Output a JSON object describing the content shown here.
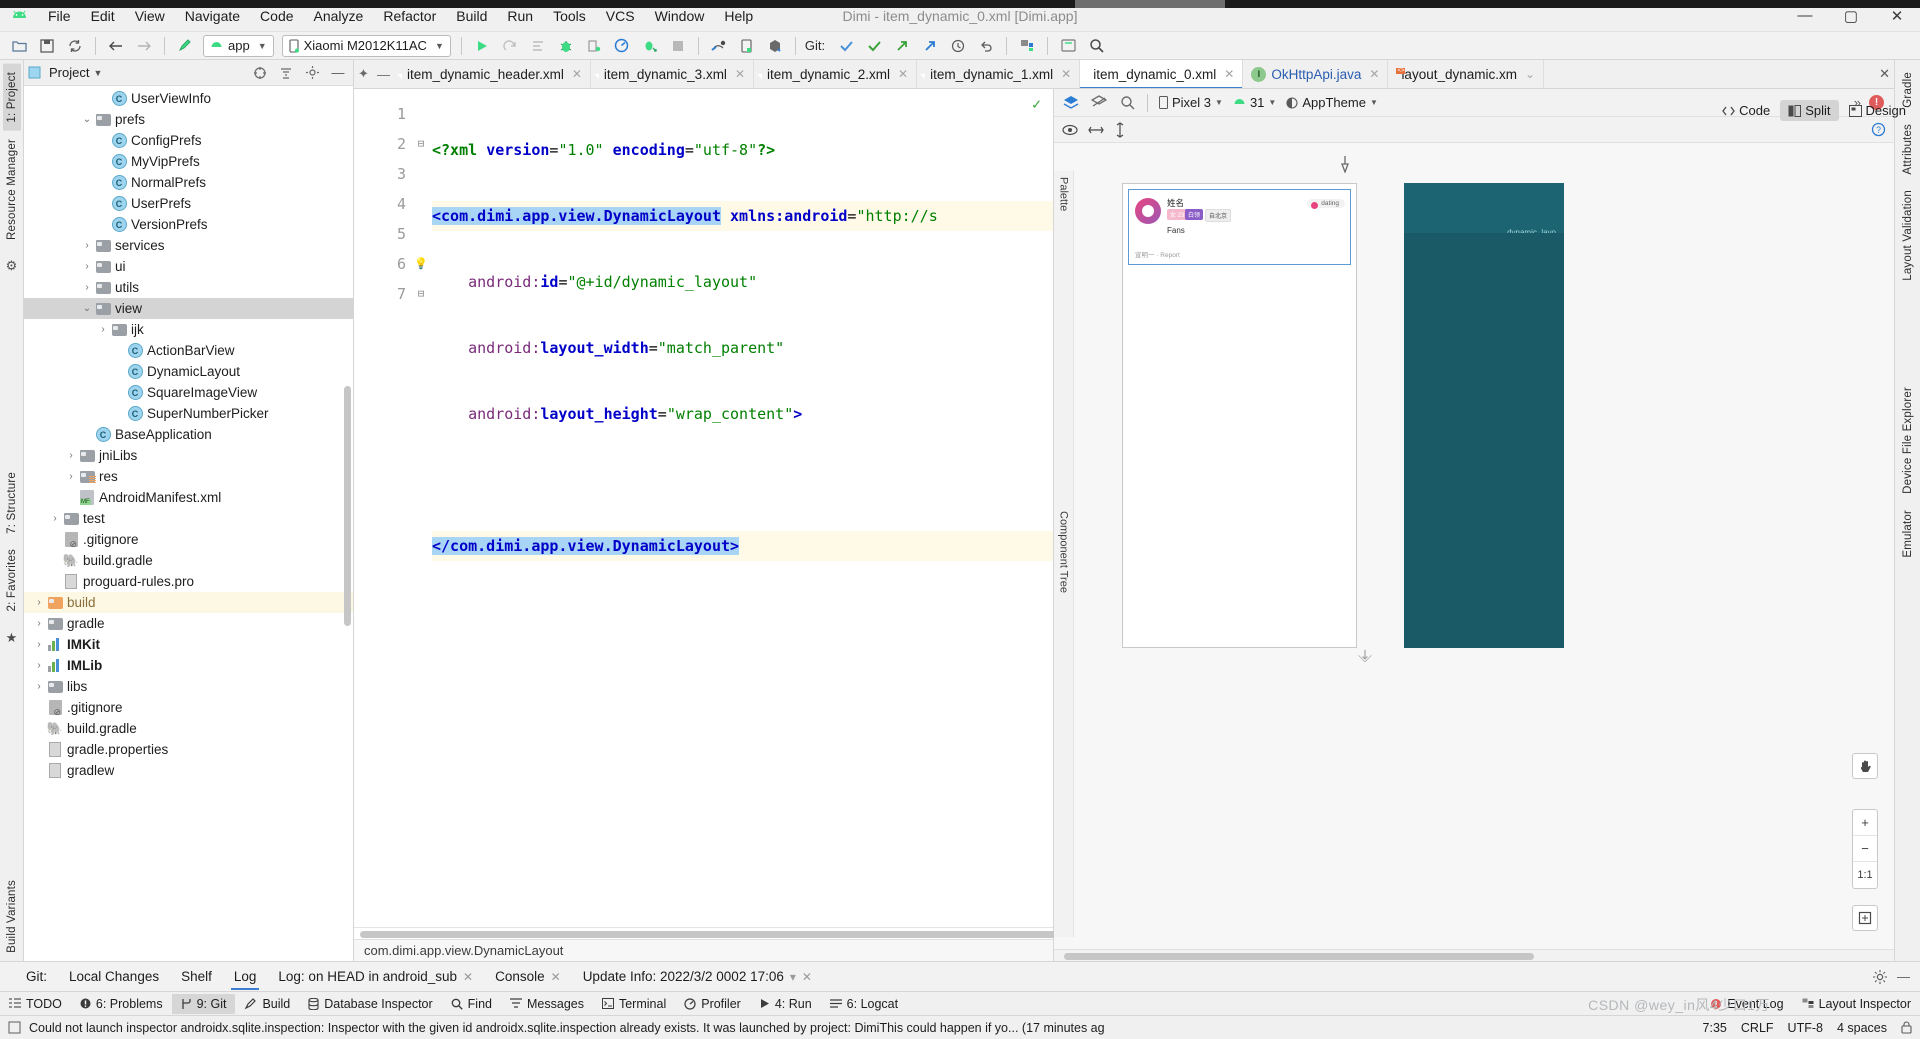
{
  "window": {
    "title": "Dimi - item_dynamic_0.xml [Dimi.app]",
    "minimize": "—",
    "maximize": "▢",
    "close": "✕"
  },
  "menu": [
    "File",
    "Edit",
    "View",
    "Navigate",
    "Code",
    "Analyze",
    "Refactor",
    "Build",
    "Run",
    "Tools",
    "VCS",
    "Window",
    "Help"
  ],
  "toolbar": {
    "module_selector": "app",
    "device_selector": "Xiaomi M2012K11AC",
    "git_label": "Git:",
    "icons": [
      "open-folder-icon",
      "save-all-icon",
      "sync-icon",
      "back-icon",
      "forward-icon",
      "build-hammer-icon",
      "run-icon",
      "rerun-icon",
      "run-config-icon",
      "debug-icon",
      "attach-debugger-icon",
      "profiler-icon",
      "apply-changes-icon",
      "stop-icon",
      "sdk-manager-icon",
      "avd-manager-icon",
      "device-explorer-icon",
      "git-update-icon",
      "git-commit-icon",
      "git-push-icon",
      "git-history-icon",
      "git-revert-icon",
      "layout-inspector-icon",
      "search-everywhere-icon"
    ]
  },
  "project_panel": {
    "title": "Project",
    "header_icons": [
      "locate-icon",
      "collapse-all-icon",
      "settings-gear-icon",
      "hide-icon"
    ],
    "tree": [
      {
        "label": "UserViewInfo",
        "indent": 7,
        "icon": "class-icon",
        "arrow": ""
      },
      {
        "label": "prefs",
        "indent": 6,
        "icon": "folder-icon",
        "arrow": "v"
      },
      {
        "label": "ConfigPrefs",
        "indent": 7,
        "icon": "class-icon",
        "arrow": ""
      },
      {
        "label": "MyVipPrefs",
        "indent": 7,
        "icon": "class-icon",
        "arrow": ""
      },
      {
        "label": "NormalPrefs",
        "indent": 7,
        "icon": "class-icon",
        "arrow": ""
      },
      {
        "label": "UserPrefs",
        "indent": 7,
        "icon": "class-icon",
        "arrow": ""
      },
      {
        "label": "VersionPrefs",
        "indent": 7,
        "icon": "class-icon",
        "arrow": ""
      },
      {
        "label": "services",
        "indent": 6,
        "icon": "folder-icon",
        "arrow": ">"
      },
      {
        "label": "ui",
        "indent": 6,
        "icon": "folder-icon",
        "arrow": ">"
      },
      {
        "label": "utils",
        "indent": 6,
        "icon": "folder-icon",
        "arrow": ">"
      },
      {
        "label": "view",
        "indent": 6,
        "icon": "folder-icon",
        "arrow": "v",
        "selected": true
      },
      {
        "label": "ijk",
        "indent": 7,
        "icon": "folder-icon",
        "arrow": ">"
      },
      {
        "label": "ActionBarView",
        "indent": 8,
        "icon": "class-icon",
        "arrow": ""
      },
      {
        "label": "DynamicLayout",
        "indent": 8,
        "icon": "class-icon",
        "arrow": ""
      },
      {
        "label": "SquareImageView",
        "indent": 8,
        "icon": "class-icon",
        "arrow": ""
      },
      {
        "label": "SuperNumberPicker",
        "indent": 8,
        "icon": "class-icon",
        "arrow": ""
      },
      {
        "label": "BaseApplication",
        "indent": 6,
        "icon": "class-icon",
        "arrow": ""
      },
      {
        "label": "jniLibs",
        "indent": 5,
        "icon": "folder-icon",
        "arrow": ">"
      },
      {
        "label": "res",
        "indent": 5,
        "icon": "folder-res-icon",
        "arrow": ">"
      },
      {
        "label": "AndroidManifest.xml",
        "indent": 5,
        "icon": "manifest-icon",
        "arrow": ""
      },
      {
        "label": "test",
        "indent": 4,
        "icon": "folder-icon",
        "arrow": ">"
      },
      {
        "label": ".gitignore",
        "indent": 4,
        "icon": "gitignore-icon",
        "arrow": ""
      },
      {
        "label": "build.gradle",
        "indent": 4,
        "icon": "gradle-icon",
        "arrow": ""
      },
      {
        "label": "proguard-rules.pro",
        "indent": 4,
        "icon": "properties-icon",
        "arrow": ""
      },
      {
        "label": "build",
        "indent": 3,
        "icon": "folder-orange-icon",
        "arrow": ">",
        "highlight": true
      },
      {
        "label": "gradle",
        "indent": 3,
        "icon": "folder-icon",
        "arrow": ">"
      },
      {
        "label": "IMKit",
        "indent": 3,
        "icon": "module-icon",
        "arrow": ">",
        "bold": true
      },
      {
        "label": "IMLib",
        "indent": 3,
        "icon": "module-icon",
        "arrow": ">",
        "bold": true
      },
      {
        "label": "libs",
        "indent": 3,
        "icon": "folder-icon",
        "arrow": ">"
      },
      {
        "label": ".gitignore",
        "indent": 3,
        "icon": "gitignore-icon",
        "arrow": ""
      },
      {
        "label": "build.gradle",
        "indent": 3,
        "icon": "gradle-icon",
        "arrow": ""
      },
      {
        "label": "gradle.properties",
        "indent": 3,
        "icon": "properties-icon",
        "arrow": ""
      },
      {
        "label": "gradlew",
        "indent": 3,
        "icon": "file-icon",
        "arrow": ""
      }
    ]
  },
  "left_rail": [
    "1: Project",
    "Resource Manager",
    "7: Structure",
    "2: Favorites"
  ],
  "right_rail": [
    "Gradle",
    "Attributes",
    "Layout Validation",
    "Device File Explorer",
    "Emulator",
    "Build Variants"
  ],
  "editor_tabs": [
    {
      "label": "item_dynamic_header.xml",
      "icon": "xml-file-icon",
      "active": false
    },
    {
      "label": "item_dynamic_3.xml",
      "icon": "xml-file-icon",
      "active": false
    },
    {
      "label": "item_dynamic_2.xml",
      "icon": "xml-file-icon",
      "active": false
    },
    {
      "label": "item_dynamic_1.xml",
      "icon": "xml-file-icon",
      "active": false
    },
    {
      "label": "item_dynamic_0.xml",
      "icon": "xml-file-icon",
      "active": true
    },
    {
      "label": "OkHttpApi.java",
      "icon": "java-file-icon",
      "active": false,
      "blue": true
    },
    {
      "label": "layout_dynamic.xm",
      "icon": "layout-file-icon",
      "active": false
    }
  ],
  "view_switch": [
    {
      "label": "Code",
      "icon": "code-view-icon",
      "active": false
    },
    {
      "label": "Split",
      "icon": "split-view-icon",
      "active": true
    },
    {
      "label": "Design",
      "icon": "design-view-icon",
      "active": false
    }
  ],
  "code": {
    "line_numbers": [
      "1",
      "2",
      "3",
      "4",
      "5",
      "6",
      "7"
    ],
    "lines": [
      "<?xml version=\"1.0\" encoding=\"utf-8\"?>",
      "<com.dimi.app.view.DynamicLayout xmlns:android=\"http://s",
      "    android:id=\"@+id/dynamic_layout\"",
      "    android:layout_width=\"match_parent\"",
      "    android:layout_height=\"wrap_content\">",
      "",
      "</com.dimi.app.view.DynamicLayout>"
    ],
    "breadcrumb": "com.dimi.app.view.DynamicLayout",
    "inspection_ok": "✓",
    "intention_bulb": "bulb-icon"
  },
  "preview": {
    "toolbar_icons": [
      "design-surface-icon",
      "blueprint-icon",
      "zoom-target-icon"
    ],
    "device": "Pixel 3",
    "api_level": "31",
    "theme": "AppTheme",
    "overflow": "»",
    "error_badge": "!",
    "eye_icon": "eye-icon",
    "horiz_icon": "horizontal-constraint-icon",
    "vert_icon": "vertical-constraint-icon",
    "help_icon": "help-icon",
    "component_tree_label": "Component Tree",
    "palette_label": "Palette",
    "zoom_in": "+",
    "zoom_out": "−",
    "zoom_actual": "1:1",
    "pan_icon": "pan-hand-icon",
    "fit_icon": "zoom-to-fit-icon",
    "mock": {
      "name": "姓名",
      "tag_pink": "女 23",
      "tag_purple": "白领",
      "tag_grey": "自北京",
      "fans": "Fans",
      "pill": "dating",
      "footer": "宣明一 · Report",
      "teal_label": "dynamic_layo"
    }
  },
  "git_panel": {
    "prefix": "Git:",
    "items": [
      {
        "label": "Local Changes",
        "closable": false,
        "active": false
      },
      {
        "label": "Shelf",
        "closable": false,
        "active": false
      },
      {
        "label": "Log",
        "closable": false,
        "active": true
      },
      {
        "label": "Log: on HEAD in android_sub",
        "closable": true,
        "active": false
      },
      {
        "label": "Console",
        "closable": true,
        "active": false
      },
      {
        "label": "Update Info: 2022/3/2 0002 17:06",
        "closable": true,
        "active": false,
        "caret": true
      }
    ],
    "right_icons": [
      "settings-gear-icon",
      "hide-panel-icon"
    ]
  },
  "tool_windows": [
    {
      "label": "TODO",
      "icon": "todo-icon",
      "active": false
    },
    {
      "label": "6: Problems",
      "icon": "problems-icon",
      "active": false
    },
    {
      "label": "9: Git",
      "icon": "git-branch-icon",
      "active": true
    },
    {
      "label": "Build",
      "icon": "build-hammer-icon",
      "active": false
    },
    {
      "label": "Database Inspector",
      "icon": "database-icon",
      "active": false
    },
    {
      "label": "Find",
      "icon": "search-icon",
      "active": false
    },
    {
      "label": "Messages",
      "icon": "messages-icon",
      "active": false
    },
    {
      "label": "Terminal",
      "icon": "terminal-icon",
      "active": false
    },
    {
      "label": "Profiler",
      "icon": "profiler-icon",
      "active": false
    },
    {
      "label": "4: Run",
      "icon": "run-icon",
      "active": false
    },
    {
      "label": "6: Logcat",
      "icon": "logcat-icon",
      "active": false
    },
    {
      "label": "Event Log",
      "icon": "event-log-icon",
      "active": false
    },
    {
      "label": "Layout Inspector",
      "icon": "layout-inspector-icon",
      "active": false
    }
  ],
  "status_bar": {
    "message": "Could not launch inspector androidx.sqlite.inspection: Inspector with the given id androidx.sqlite.inspection already exists. It was launched by project: DimiThis could happen if yo... (17 minutes ag",
    "message_icon": "notification-icon",
    "caret_position": "7:35",
    "line_separator": "CRLF",
    "encoding": "UTF-8",
    "indent": "4 spaces",
    "lock_icon": "lock-icon"
  },
  "watermark": "CSDN @wey_in风4少口1万",
  "colors": {
    "accent_blue": "#3c7fd0",
    "selection_blue": "#a8d4f5",
    "highlight_yellow": "#fffae8",
    "teal": "#1c6471",
    "green": "#3aa33a"
  }
}
